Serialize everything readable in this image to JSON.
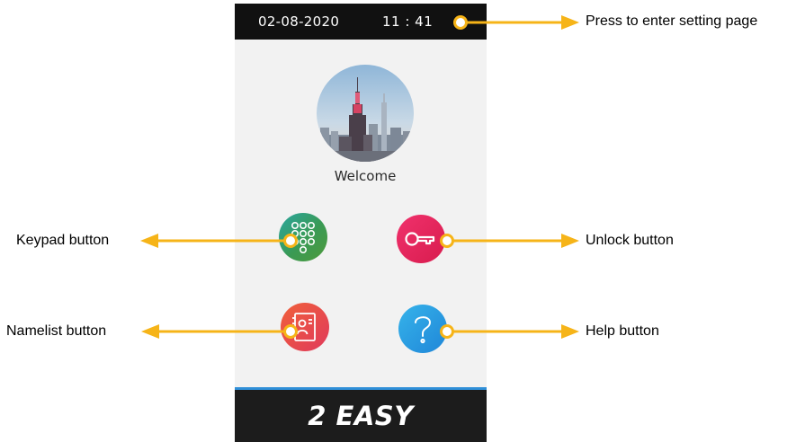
{
  "status_bar": {
    "date": "02-08-2020",
    "time": "11 : 41"
  },
  "screen": {
    "welcome_text": "Welcome",
    "brand": "2 EASY"
  },
  "buttons": {
    "keypad": {
      "icon": "keypad-icon",
      "color": "#3a9a54"
    },
    "unlock": {
      "icon": "key-icon",
      "color": "#d81c4e"
    },
    "namelist": {
      "icon": "contact-card-icon",
      "color": "#e8474c"
    },
    "help": {
      "icon": "question-mark-icon",
      "color": "#2a9be0"
    }
  },
  "callouts": {
    "settings": "Press to enter setting page",
    "keypad": "Keypad button",
    "unlock": "Unlock button",
    "namelist": "Namelist button",
    "help": "Help button"
  },
  "colors": {
    "arrow": "#f6b418",
    "status_bar": "#111111",
    "accent_line": "#2f8fd8"
  }
}
